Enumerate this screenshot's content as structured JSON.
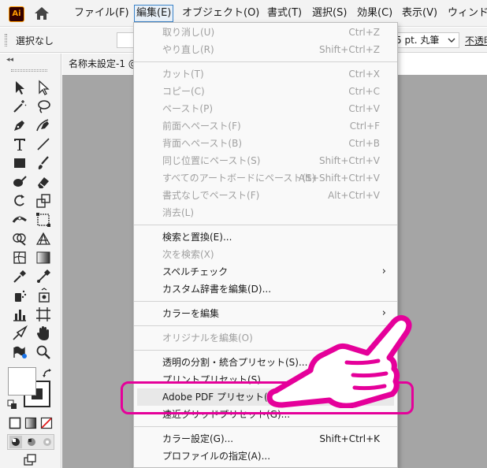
{
  "app": {
    "logo_text": "Ai"
  },
  "menubar": {
    "items": [
      {
        "label": "ファイル(F)"
      },
      {
        "label": "編集(E)"
      },
      {
        "label": "オブジェクト(O)"
      },
      {
        "label": "書式(T)"
      },
      {
        "label": "選択(S)"
      },
      {
        "label": "効果(C)"
      },
      {
        "label": "表示(V)"
      },
      {
        "label": "ウィンドウ"
      }
    ]
  },
  "controlbar": {
    "selection_label": "選択なし",
    "brush_value": "5 pt. 丸筆",
    "opacity_label": "不透明"
  },
  "document": {
    "tab_title": "名称未設定-1 @"
  },
  "edit_menu": {
    "items": [
      {
        "label": "取り消し(U)",
        "shortcut": "Ctrl+Z"
      },
      {
        "label": "やり直し(R)",
        "shortcut": "Shift+Ctrl+Z"
      },
      {
        "label": "カット(T)",
        "shortcut": "Ctrl+X"
      },
      {
        "label": "コピー(C)",
        "shortcut": "Ctrl+C"
      },
      {
        "label": "ペースト(P)",
        "shortcut": "Ctrl+V"
      },
      {
        "label": "前面へペースト(F)",
        "shortcut": "Ctrl+F"
      },
      {
        "label": "背面へペースト(B)",
        "shortcut": "Ctrl+B"
      },
      {
        "label": "同じ位置にペースト(S)",
        "shortcut": "Shift+Ctrl+V"
      },
      {
        "label": "すべてのアートボードにペースト(S)",
        "shortcut": "Alt+Shift+Ctrl+V"
      },
      {
        "label": "書式なしでペースト(F)",
        "shortcut": "Alt+Ctrl+V"
      },
      {
        "label": "消去(L)"
      },
      {
        "label": "検索と置換(E)..."
      },
      {
        "label": "次を検索(X)"
      },
      {
        "label": "スペルチェック",
        "submenu": "›"
      },
      {
        "label": "カスタム辞書を編集(D)..."
      },
      {
        "label": "カラーを編集",
        "submenu": "›"
      },
      {
        "label": "オリジナルを編集(O)"
      },
      {
        "label": "透明の分割・統合プリセット(S)..."
      },
      {
        "label": "プリントプリセット(S)..."
      },
      {
        "label": "Adobe PDF プリセット(S)..."
      },
      {
        "label": "遠近グリッドプリセット(G)..."
      },
      {
        "label": "カラー設定(G)...",
        "shortcut": "Shift+Ctrl+K"
      },
      {
        "label": "プロファイルの指定(A)..."
      }
    ]
  },
  "annotation": {
    "accent_color": "#e5009a"
  }
}
